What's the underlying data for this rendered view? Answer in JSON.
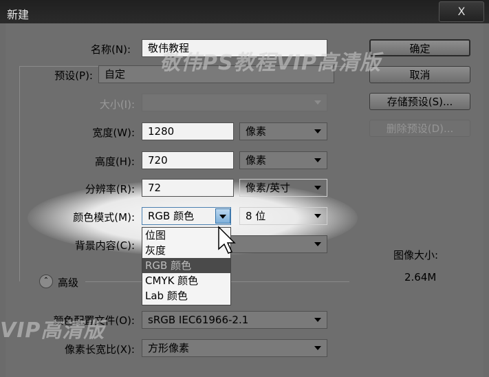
{
  "window": {
    "title": "新建",
    "close_label": "X"
  },
  "watermark": {
    "main": "敬伟PS教程VIP高清版",
    "left": "VIP高清版"
  },
  "form": {
    "name_label": "名称(N):",
    "name_value": "敬伟教程",
    "preset_label": "预设(P):",
    "preset_value": "自定",
    "size_label": "大小(I):",
    "size_value": "",
    "width_label": "宽度(W):",
    "width_value": "1280",
    "width_unit": "像素",
    "height_label": "高度(H):",
    "height_value": "720",
    "height_unit": "像素",
    "resolution_label": "分辨率(R):",
    "resolution_value": "72",
    "resolution_unit": "像素/英寸",
    "color_mode_label": "颜色模式(M):",
    "color_mode_value": "RGB 颜色",
    "bit_depth_value": "8 位",
    "background_label": "背景内容(C):",
    "advanced_label": "高级",
    "color_profile_label": "颜色配置文件(O):",
    "color_profile_value": "sRGB IEC61966-2.1",
    "pixel_aspect_label": "像素长宽比(X):",
    "pixel_aspect_value": "方形像素"
  },
  "color_mode_menu": {
    "options": [
      "位图",
      "灰度",
      "RGB 颜色",
      "CMYK 颜色",
      "Lab 颜色"
    ],
    "selected": "RGB 颜色"
  },
  "buttons": {
    "ok": "确定",
    "cancel": "取消",
    "save_preset": "存储预设(S)...",
    "delete_preset": "删除预设(D)..."
  },
  "image_size": {
    "label": "图像大小:",
    "value": "2.64M"
  }
}
